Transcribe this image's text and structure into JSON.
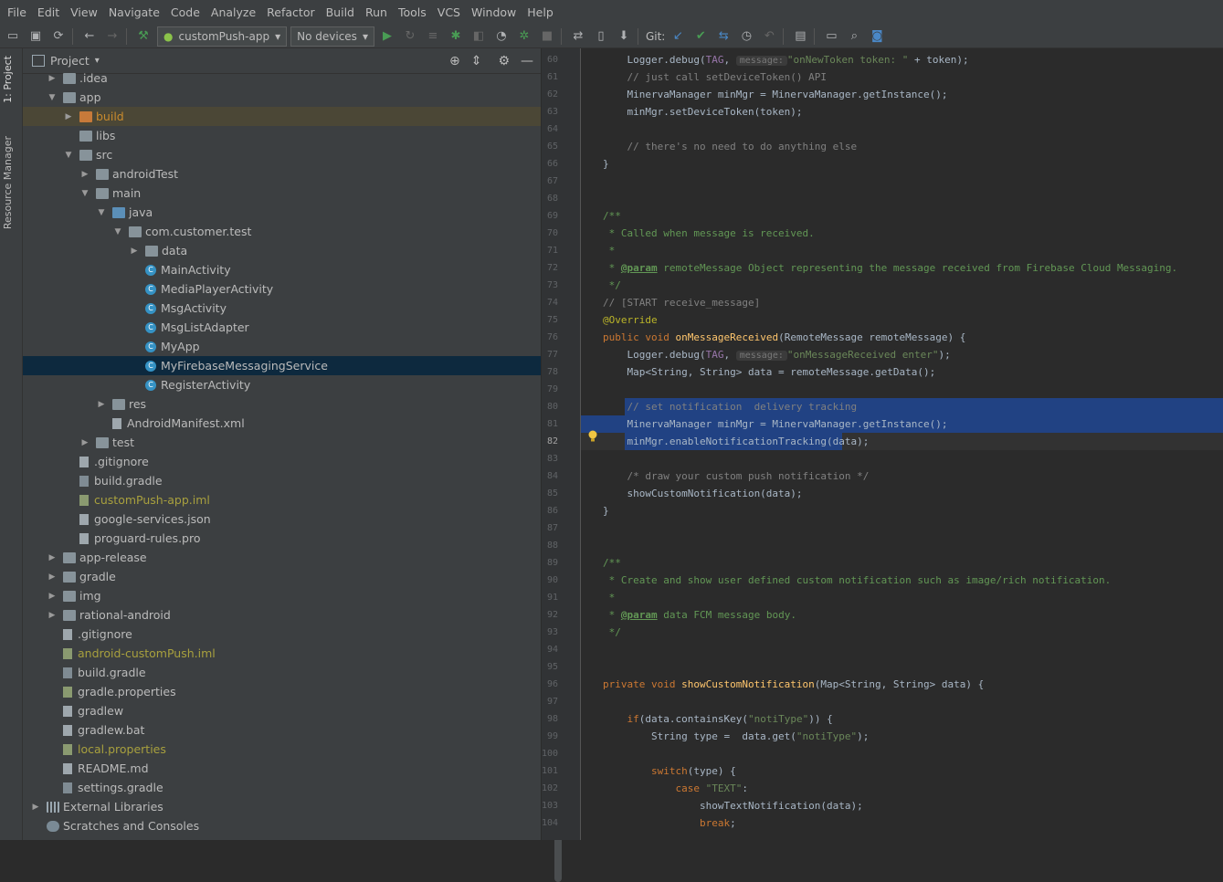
{
  "menu": [
    "File",
    "Edit",
    "View",
    "Navigate",
    "Code",
    "Analyze",
    "Refactor",
    "Build",
    "Run",
    "Tools",
    "VCS",
    "Window",
    "Help"
  ],
  "toolbar": {
    "run_config": "customPush-app",
    "device": "No devices",
    "git_label": "Git:"
  },
  "left_strip": {
    "project_tab": "1: Project",
    "resource_tab": "Resource Manager"
  },
  "project_panel": {
    "title": "Project",
    "tree": [
      {
        "label": ".idea",
        "depth": 1,
        "arrow": "right",
        "icon": "folder"
      },
      {
        "label": "app",
        "depth": 1,
        "arrow": "down",
        "icon": "folder-module"
      },
      {
        "label": "build",
        "depth": 2,
        "arrow": "right",
        "icon": "folder-excluded",
        "style": "orange",
        "highlight": "build"
      },
      {
        "label": "libs",
        "depth": 2,
        "arrow": "",
        "icon": "folder"
      },
      {
        "label": "src",
        "depth": 2,
        "arrow": "down",
        "icon": "folder"
      },
      {
        "label": "androidTest",
        "depth": 3,
        "arrow": "right",
        "icon": "folder"
      },
      {
        "label": "main",
        "depth": 3,
        "arrow": "down",
        "icon": "folder"
      },
      {
        "label": "java",
        "depth": 4,
        "arrow": "down",
        "icon": "folder-source"
      },
      {
        "label": "com.customer.test",
        "depth": 5,
        "arrow": "down",
        "icon": "package"
      },
      {
        "label": "data",
        "depth": 6,
        "arrow": "right",
        "icon": "package"
      },
      {
        "label": "MainActivity",
        "depth": 6,
        "arrow": "",
        "icon": "class"
      },
      {
        "label": "MediaPlayerActivity",
        "depth": 6,
        "arrow": "",
        "icon": "class"
      },
      {
        "label": "MsgActivity",
        "depth": 6,
        "arrow": "",
        "icon": "class"
      },
      {
        "label": "MsgListAdapter",
        "depth": 6,
        "arrow": "",
        "icon": "class"
      },
      {
        "label": "MyApp",
        "depth": 6,
        "arrow": "",
        "icon": "class"
      },
      {
        "label": "MyFirebaseMessagingService",
        "depth": 6,
        "arrow": "",
        "icon": "class",
        "highlight": "selected"
      },
      {
        "label": "RegisterActivity",
        "depth": 6,
        "arrow": "",
        "icon": "class"
      },
      {
        "label": "res",
        "depth": 4,
        "arrow": "right",
        "icon": "folder-res"
      },
      {
        "label": "AndroidManifest.xml",
        "depth": 4,
        "arrow": "",
        "icon": "manifest"
      },
      {
        "label": "test",
        "depth": 3,
        "arrow": "right",
        "icon": "folder"
      },
      {
        "label": ".gitignore",
        "depth": 2,
        "arrow": "",
        "icon": "file"
      },
      {
        "label": "build.gradle",
        "depth": 2,
        "arrow": "",
        "icon": "gradle"
      },
      {
        "label": "customPush-app.iml",
        "depth": 2,
        "arrow": "",
        "icon": "iml",
        "style": "olive"
      },
      {
        "label": "google-services.json",
        "depth": 2,
        "arrow": "",
        "icon": "json"
      },
      {
        "label": "proguard-rules.pro",
        "depth": 2,
        "arrow": "",
        "icon": "file"
      },
      {
        "label": "app-release",
        "depth": 1,
        "arrow": "right",
        "icon": "folder-module"
      },
      {
        "label": "gradle",
        "depth": 1,
        "arrow": "right",
        "icon": "folder"
      },
      {
        "label": "img",
        "depth": 1,
        "arrow": "right",
        "icon": "folder"
      },
      {
        "label": "rational-android",
        "depth": 1,
        "arrow": "right",
        "icon": "folder"
      },
      {
        "label": ".gitignore",
        "depth": 1,
        "arrow": "",
        "icon": "file"
      },
      {
        "label": "android-customPush.iml",
        "depth": 1,
        "arrow": "",
        "icon": "iml",
        "style": "olive"
      },
      {
        "label": "build.gradle",
        "depth": 1,
        "arrow": "",
        "icon": "gradle"
      },
      {
        "label": "gradle.properties",
        "depth": 1,
        "arrow": "",
        "icon": "properties"
      },
      {
        "label": "gradlew",
        "depth": 1,
        "arrow": "",
        "icon": "file"
      },
      {
        "label": "gradlew.bat",
        "depth": 1,
        "arrow": "",
        "icon": "file"
      },
      {
        "label": "local.properties",
        "depth": 1,
        "arrow": "",
        "icon": "properties",
        "style": "olive"
      },
      {
        "label": "README.md",
        "depth": 1,
        "arrow": "",
        "icon": "file"
      },
      {
        "label": "settings.gradle",
        "depth": 1,
        "arrow": "",
        "icon": "gradle"
      },
      {
        "label": "External Libraries",
        "depth": 0,
        "arrow": "right",
        "icon": "libraries"
      },
      {
        "label": "Scratches and Consoles",
        "depth": 0,
        "arrow": "",
        "icon": "scratches"
      }
    ]
  },
  "editor": {
    "first_line": 60,
    "current_line": 82,
    "selection_lines": [
      80,
      81
    ],
    "lines": [
      [
        [
          "",
          "    "
        ],
        [
          "",
          "Logger.debug("
        ],
        [
          "field",
          "TAG"
        ],
        [
          "",
          ", "
        ],
        [
          "hint",
          "message:"
        ],
        [
          "str",
          "\"onNewToken token: \""
        ],
        [
          "",
          " + token);"
        ]
      ],
      [
        [
          "cm",
          "    // just call setDeviceToken() API"
        ]
      ],
      [
        [
          "",
          "    MinervaManager minMgr = MinervaManager.getInstance();"
        ]
      ],
      [
        [
          "",
          "    minMgr.setDeviceToken(token);"
        ]
      ],
      [],
      [
        [
          "cm",
          "    // there's no need to do anything else"
        ]
      ],
      [
        [
          "",
          "}"
        ]
      ],
      [],
      [],
      [
        [
          "doc",
          "/**"
        ]
      ],
      [
        [
          "doc",
          " * Called when message is received."
        ]
      ],
      [
        [
          "doc",
          " *"
        ]
      ],
      [
        [
          "doc",
          " * "
        ],
        [
          "tagb",
          "@param"
        ],
        [
          "doc",
          " remoteMessage Object representing the message received from Firebase Cloud Messaging."
        ]
      ],
      [
        [
          "doc",
          " */"
        ]
      ],
      [
        [
          "cm",
          "// [START receive_message]"
        ]
      ],
      [
        [
          "ann",
          "@Override"
        ]
      ],
      [
        [
          "kw",
          "public void "
        ],
        [
          "fn",
          "onMessageReceived"
        ],
        [
          "",
          "(RemoteMessage remoteMessage) {"
        ]
      ],
      [
        [
          "",
          "    Logger.debug("
        ],
        [
          "field",
          "TAG"
        ],
        [
          "",
          ", "
        ],
        [
          "hint",
          "message:"
        ],
        [
          "str",
          "\"onMessageReceived enter\""
        ],
        [
          "",
          ");"
        ]
      ],
      [
        [
          "",
          "    Map<String, String> data = remoteMessage.getData();"
        ]
      ],
      [],
      [
        [
          "cm",
          "    // set notification  delivery tracking"
        ]
      ],
      [
        [
          "",
          "    MinervaManager minMgr = MinervaManager.getInstance();"
        ]
      ],
      [
        [
          "",
          "    minMgr.enableNotificationTracking(data);"
        ]
      ],
      [],
      [
        [
          "cm",
          "    /* draw your custom push notification */"
        ]
      ],
      [
        [
          "",
          "    showCustomNotification(data);"
        ]
      ],
      [
        [
          "",
          "}"
        ]
      ],
      [],
      [],
      [
        [
          "doc",
          "/**"
        ]
      ],
      [
        [
          "doc",
          " * Create and show user defined custom notification such as image/rich notification."
        ]
      ],
      [
        [
          "doc",
          " *"
        ]
      ],
      [
        [
          "doc",
          " * "
        ],
        [
          "tagb",
          "@param"
        ],
        [
          "doc",
          " data FCM message body."
        ]
      ],
      [
        [
          "doc",
          " */"
        ]
      ],
      [],
      [],
      [
        [
          "kw",
          "private void "
        ],
        [
          "fn",
          "showCustomNotification"
        ],
        [
          "",
          "(Map<String, String> data) {"
        ]
      ],
      [],
      [
        [
          "",
          "    "
        ],
        [
          "kw",
          "if"
        ],
        [
          "",
          "(data.containsKey("
        ],
        [
          "str",
          "\"notiType\""
        ],
        [
          "",
          ")) {"
        ]
      ],
      [
        [
          "",
          "        String type =  data.get("
        ],
        [
          "str",
          "\"notiType\""
        ],
        [
          "",
          ");"
        ]
      ],
      [],
      [
        [
          "",
          "        "
        ],
        [
          "kw",
          "switch"
        ],
        [
          "",
          "(type) {"
        ]
      ],
      [
        [
          "",
          "            "
        ],
        [
          "kw",
          "case "
        ],
        [
          "str",
          "\"TEXT\""
        ],
        [
          "",
          ":"
        ]
      ],
      [
        [
          "",
          "                showTextNotification(data);"
        ]
      ],
      [
        [
          "",
          "                "
        ],
        [
          "kw",
          "break"
        ],
        [
          "",
          ";"
        ]
      ]
    ]
  }
}
